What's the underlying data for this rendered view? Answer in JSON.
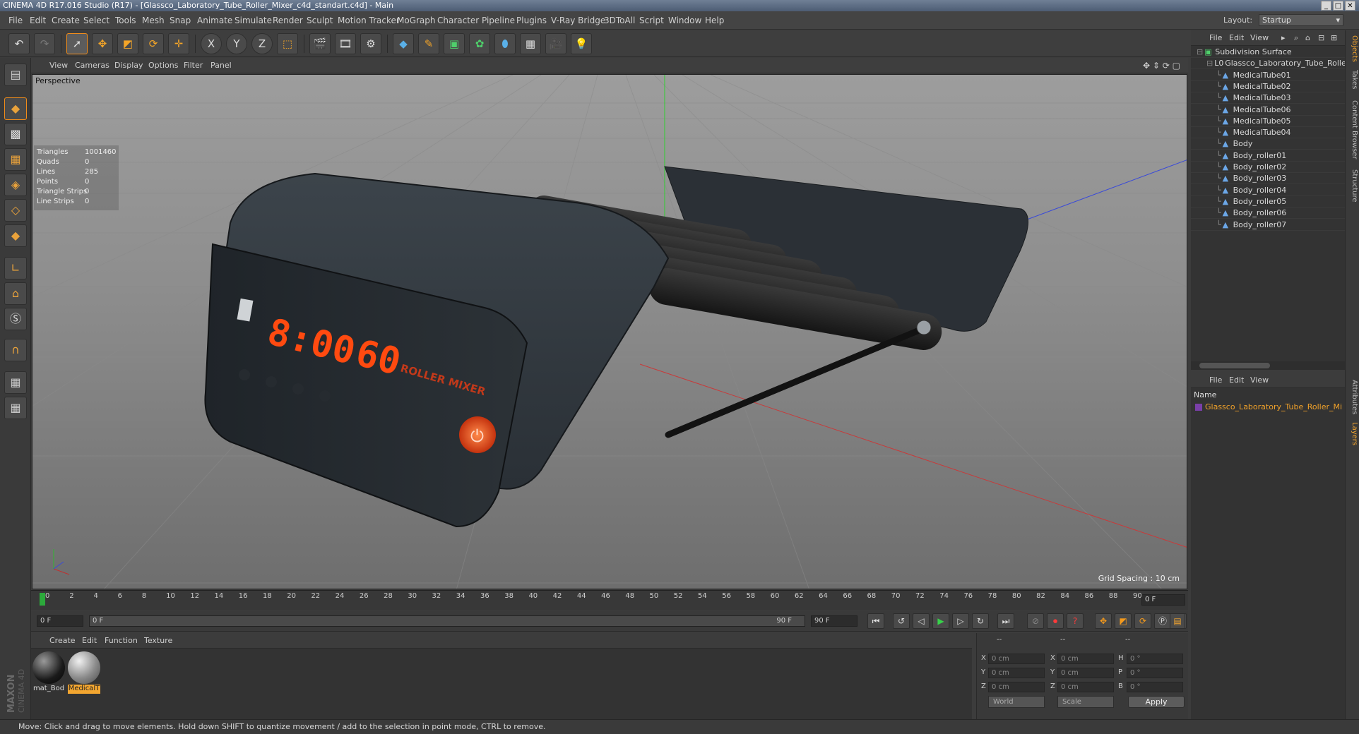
{
  "window": {
    "title": "CINEMA 4D R17.016 Studio (R17) - [Glassco_Laboratory_Tube_Roller_Mixer_c4d_standart.c4d] - Main"
  },
  "menu": {
    "items": [
      "File",
      "Edit",
      "Create",
      "Select",
      "Tools",
      "Mesh",
      "Snap",
      "Animate",
      "Simulate",
      "Render",
      "Sculpt",
      "Motion Tracker",
      "MoGraph",
      "Character",
      "Pipeline",
      "Plugins",
      "V-Ray Bridge",
      "3DToAll",
      "Script",
      "Window",
      "Help"
    ],
    "layout_label": "Layout:",
    "layout_value": "Startup"
  },
  "toolbar": {
    "x": "X",
    "y": "Y",
    "z": "Z"
  },
  "viewport": {
    "menu": [
      "View",
      "Cameras",
      "Display",
      "Options",
      "Filter",
      "Panel"
    ],
    "camera": "Perspective",
    "grid_spacing": "Grid Spacing : 10 cm",
    "stats": [
      {
        "label": "Triangles",
        "value": "1001460"
      },
      {
        "label": "Quads",
        "value": "0"
      },
      {
        "label": "Lines",
        "value": "285"
      },
      {
        "label": "Points",
        "value": "0"
      },
      {
        "label": "Triangle Strips",
        "value": "0"
      },
      {
        "label": "Line Strips",
        "value": "0"
      }
    ],
    "display_digits": "8:00",
    "display_speed": "60",
    "display_brand": "ROLLER MIXER"
  },
  "timeline": {
    "ticks": [
      "0",
      "2",
      "4",
      "6",
      "8",
      "10",
      "12",
      "14",
      "16",
      "18",
      "20",
      "22",
      "24",
      "26",
      "28",
      "30",
      "32",
      "34",
      "36",
      "38",
      "40",
      "42",
      "44",
      "46",
      "48",
      "50",
      "52",
      "54",
      "56",
      "58",
      "60",
      "62",
      "64",
      "66",
      "68",
      "70",
      "72",
      "74",
      "76",
      "78",
      "80",
      "82",
      "84",
      "86",
      "88",
      "90"
    ],
    "current_frame": "0 F"
  },
  "transport": {
    "start_frame": "0 F",
    "range_start": "0 F",
    "range_end": "90 F",
    "end_frame": "90 F"
  },
  "materials": {
    "menu": [
      "Create",
      "Edit",
      "Function",
      "Texture"
    ],
    "items": [
      {
        "name": "mat_Bod",
        "selected": false
      },
      {
        "name": "MedicalT",
        "selected": true
      }
    ]
  },
  "coords": {
    "headers": [
      "--",
      "--",
      "--"
    ],
    "rows": [
      {
        "a": "X",
        "av": "0 cm",
        "b": "X",
        "bv": "0 cm",
        "c": "H",
        "cv": "0 °"
      },
      {
        "a": "Y",
        "av": "0 cm",
        "b": "Y",
        "bv": "0 cm",
        "c": "P",
        "cv": "0 °"
      },
      {
        "a": "Z",
        "av": "0 cm",
        "b": "Z",
        "bv": "0 cm",
        "c": "B",
        "cv": "0 °"
      }
    ],
    "mode_world": "World",
    "mode_scale": "Scale",
    "apply": "Apply"
  },
  "status": {
    "text": "Move: Click and drag to move elements. Hold down SHIFT to quantize movement / add to the selection in point mode, CTRL to remove."
  },
  "objects": {
    "menu": [
      "File",
      "Edit",
      "View"
    ],
    "tree": [
      {
        "name": "Subdivision Surface",
        "depth": 0,
        "icon": "subdivision-icon"
      },
      {
        "name": "Glassco_Laboratory_Tube_Roller_N",
        "depth": 1,
        "icon": "null-icon"
      },
      {
        "name": "MedicalTube01",
        "depth": 2,
        "icon": "polygon-icon"
      },
      {
        "name": "MedicalTube02",
        "depth": 2,
        "icon": "polygon-icon"
      },
      {
        "name": "MedicalTube03",
        "depth": 2,
        "icon": "polygon-icon"
      },
      {
        "name": "MedicalTube06",
        "depth": 2,
        "icon": "polygon-icon"
      },
      {
        "name": "MedicalTube05",
        "depth": 2,
        "icon": "polygon-icon"
      },
      {
        "name": "MedicalTube04",
        "depth": 2,
        "icon": "polygon-icon"
      },
      {
        "name": "Body",
        "depth": 2,
        "icon": "polygon-icon"
      },
      {
        "name": "Body_roller01",
        "depth": 2,
        "icon": "polygon-icon"
      },
      {
        "name": "Body_roller02",
        "depth": 2,
        "icon": "polygon-icon"
      },
      {
        "name": "Body_roller03",
        "depth": 2,
        "icon": "polygon-icon"
      },
      {
        "name": "Body_roller04",
        "depth": 2,
        "icon": "polygon-icon"
      },
      {
        "name": "Body_roller05",
        "depth": 2,
        "icon": "polygon-icon"
      },
      {
        "name": "Body_roller06",
        "depth": 2,
        "icon": "polygon-icon"
      },
      {
        "name": "Body_roller07",
        "depth": 2,
        "icon": "polygon-icon"
      }
    ]
  },
  "layers": {
    "menu": [
      "File",
      "Edit",
      "View"
    ],
    "column": "Name",
    "item": "Glassco_Laboratory_Tube_Roller_Mi"
  },
  "side_tabs": [
    {
      "label": "Objects",
      "active": true
    },
    {
      "label": "Takes",
      "active": false
    },
    {
      "label": "Content Browser",
      "active": false
    },
    {
      "label": "Structure",
      "active": false
    },
    {
      "label": "Attributes",
      "active": false
    },
    {
      "label": "Layers",
      "active": true
    }
  ],
  "colors": {
    "accent": "#f08c1a",
    "selection": "#f4a528",
    "play": "#37d24a"
  }
}
